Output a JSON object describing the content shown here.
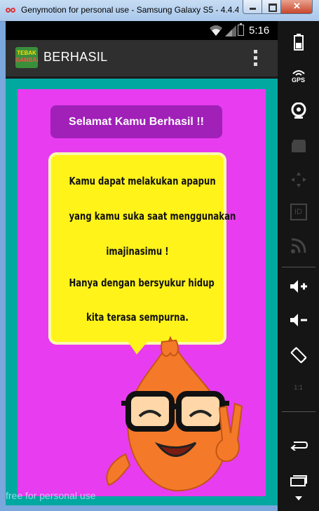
{
  "window": {
    "title": "Genymotion for personal use - Samsung Galaxy S5 - 4.4.4..."
  },
  "statusbar": {
    "time": "5:16"
  },
  "actionbar": {
    "logo_line1": "TEBAK",
    "logo_line2": "GAMBAR",
    "title": "BERHASIL"
  },
  "content": {
    "banner": "Selamat Kamu Berhasil !!",
    "message_lines": [
      "Kamu dapat melakukan apapun",
      "yang kamu suka saat menggunakan",
      "imajinasimu !",
      "Hanya dengan bersyukur hidup",
      "kita terasa sempurna."
    ]
  },
  "watermark": "free for personal use",
  "sidebar": {
    "gps_label": "GPS",
    "id_label": "ID",
    "ratio_label": "1:1"
  },
  "colors": {
    "content_bg": "#e83cf0",
    "bubble": "#fff31a",
    "screen_bg": "#00a8a0",
    "banner": "#a020b8"
  }
}
